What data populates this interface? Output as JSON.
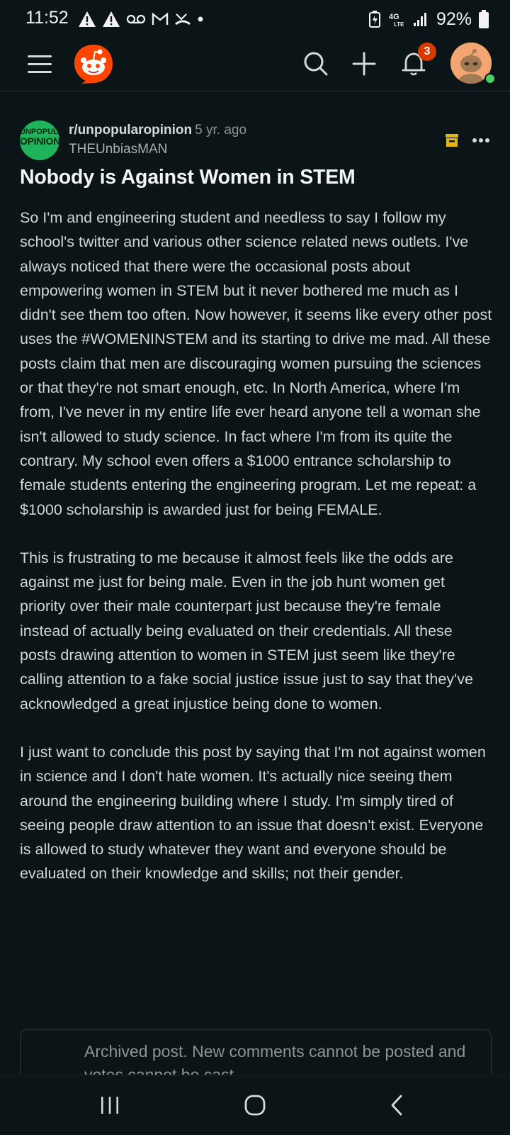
{
  "status_bar": {
    "time": "11:52",
    "network": "4G LTE",
    "battery": "92%"
  },
  "header": {
    "menu_icon": "menu-icon",
    "logo": "reddit-logo",
    "search_icon": "search-icon",
    "create_icon": "plus-icon",
    "notifications_icon": "bell-icon",
    "notifications_count": "3",
    "avatar": "snoo-avatar"
  },
  "post": {
    "subreddit": "r/unpopularopinion",
    "subreddit_icon_line1": "UNPOPULAR",
    "subreddit_icon_line2": "OPINION",
    "age": "5 yr. ago",
    "author": "THEUnbiasMAN",
    "title": "Nobody is Against Women in STEM",
    "body": [
      "So I'm and engineering student and needless to say I follow my school's twitter and various other science related news outlets. I've always noticed that there were the occasional posts about empowering women in STEM but it never bothered me much as I didn't see them too often. Now however, it seems like every other post uses the #WOMENINSTEM and its starting to drive me mad. All these posts claim that men are discouraging women pursuing the sciences or that they're not smart enough, etc. In North America, where I'm from, I've never in my entire life ever heard anyone tell a woman she isn't allowed to study science. In fact where I'm from its quite the contrary. My school even offers a $1000 entrance scholarship to female students entering the engineering program. Let me repeat: a $1000 scholarship is awarded just for being FEMALE.",
      "This is frustrating to me because it almost feels like the odds are against me just for being male. Even in the job hunt women get priority over their male counterpart just because they're female instead of actually being evaluated on their credentials. All these posts drawing attention to women in STEM just seem like they're calling attention to a fake social justice issue just to say that they've acknowledged a great injustice being done to women.",
      "I just want to conclude this post by saying that I'm not against women in science and I don't hate women. It's actually nice seeing them around the engineering building where I study. I'm simply tired of seeing people draw attention to an issue that doesn't exist. Everyone is allowed to study whatever they want and everyone should be evaluated on their knowledge and skills; not their gender."
    ],
    "archived_notice": "Archived post. New comments cannot be posted and votes cannot be cast."
  },
  "colors": {
    "background": "#0b1416",
    "brand": "#ff4500",
    "badge": "#d93a00",
    "archive_icon": "#e2b714",
    "subreddit_icon_bg": "#1fb35b"
  },
  "nav": {
    "recents_icon": "recent-apps-icon",
    "home_icon": "home-icon",
    "back_icon": "back-icon"
  }
}
